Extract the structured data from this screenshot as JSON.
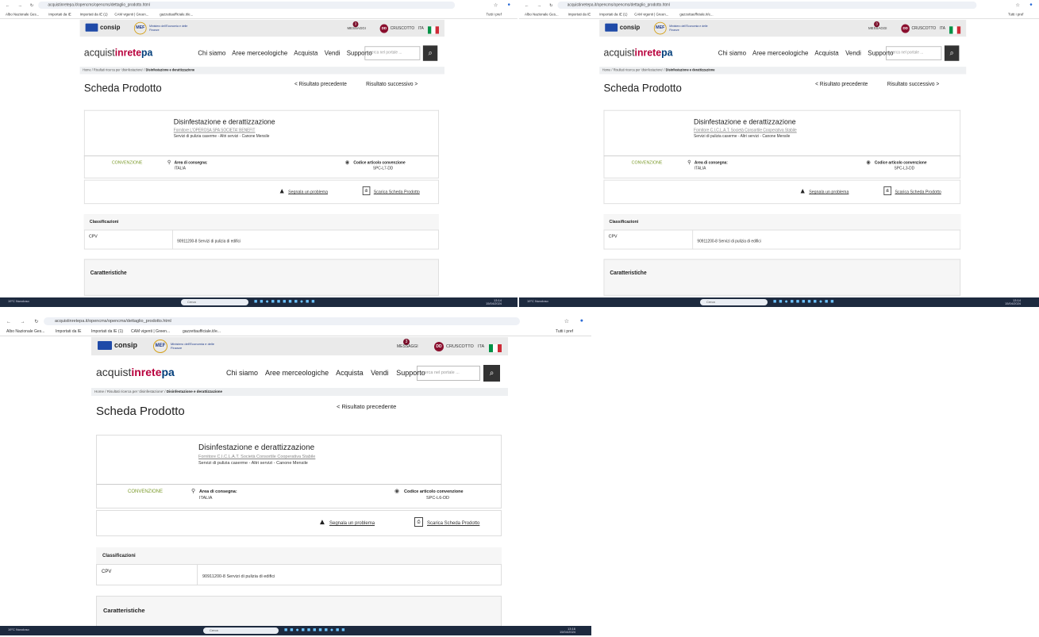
{
  "browser": {
    "url": "acquistinretepa.it/opencms/opencms/dettaglio_prodotto.html",
    "bookmarks": [
      "Albo Nazionale Ges...",
      "Importati da IE",
      "Importati da IE (1)",
      "CAM vigenti | Green...",
      "gazzettaufficiale.it/e..."
    ],
    "bookmarks_right": "Tutti i pref"
  },
  "header": {
    "consip": "consip",
    "mef": "MEF",
    "ministero": "Ministero dell'Economia e delle Finanze",
    "messaggi": "MESSAGGI",
    "msg_count": "3",
    "cruscotto": "CRUSCOTTO",
    "dd": "DD",
    "lang": "ITA"
  },
  "nav": {
    "logo_a": "acquist",
    "logo_b": "inrete",
    "logo_c": "pa",
    "items": [
      "Chi siamo",
      "Aree merceologiche",
      "Acquista",
      "Vendi",
      "Supporto"
    ],
    "search_placeholder": "cerca nel portale ..."
  },
  "breadcrumb": {
    "home": "Home",
    "step": "Risultati ricerca per 'disinfestazione'",
    "current": "Disinfestazione e derattizzazione"
  },
  "panels": [
    {
      "prev": "< Risultato precedente",
      "next": "Risultato successivo >",
      "fornitore": "Fornitore L'OPEROSA SPA SOCIETA' BENEFIT",
      "codice": "SPC-L7-DD"
    },
    {
      "prev": "< Risultato precedente",
      "next": "Risultato successivo >",
      "fornitore": "Fornitore C.I.C.L.A.T. Società Consortile Cooperativa Stabile",
      "codice": "SPC-L3-DD"
    },
    {
      "prev": "< Risultato precedente",
      "next": "",
      "fornitore": "Fornitore C.I.C.L.A.T. Società Consortile Cooperativa Stabile",
      "codice": "SPC-L6-DD"
    }
  ],
  "product": {
    "page_title": "Scheda Prodotto",
    "name": "Disinfestazione e derattizzazione",
    "servizi": "Servizi di pulizia caserme - Altri servizi - Canone Mensile",
    "convenzione": "CONVENZIONE",
    "area_label": "Area di consegna:",
    "area_value": "ITALIA",
    "codice_label": "Codice articolo convenzione",
    "segnala": "Segnala un problema",
    "scarica": "Scarica Scheda Prodotto",
    "classificazioni": "Classificazioni",
    "cpv_label": "CPV",
    "cpv_value": "90911200-8 Servizi di pulizia di edifici",
    "caratteristiche": "Caratteristiche"
  },
  "taskbar": {
    "weather": "19°C Nuvoloso",
    "search": "Cerca",
    "time": "13:14",
    "date": "15/04/2024",
    "time2": "13:16"
  },
  "colors": {
    "brand_red": "#b8003c",
    "brand_blue": "#003d7a",
    "convenzione_green": "#7a9a2a",
    "taskbar": "#1d2a3f"
  }
}
